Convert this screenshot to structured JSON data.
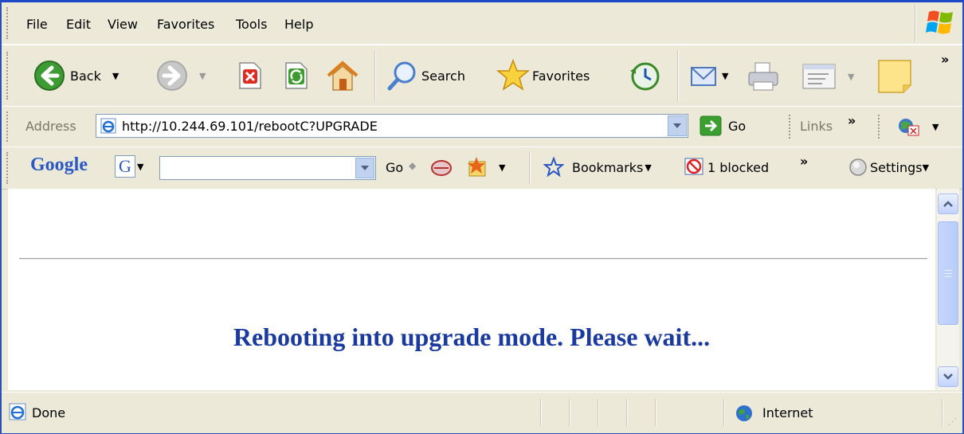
{
  "menu": {
    "items": [
      "File",
      "Edit",
      "View",
      "Favorites",
      "Tools",
      "Help"
    ]
  },
  "toolbar": {
    "back_label": "Back",
    "search_label": "Search",
    "favorites_label": "Favorites"
  },
  "address": {
    "label": "Address",
    "url": "http://10.244.69.101/rebootC?UPGRADE",
    "go_label": "Go",
    "links_label": "Links"
  },
  "google_bar": {
    "logo": "Google",
    "search_value": "",
    "go_label": "Go",
    "bookmarks_label": "Bookmarks",
    "blocked_label": "1 blocked",
    "settings_label": "Settings"
  },
  "page": {
    "message": "Rebooting into upgrade mode. Please wait..."
  },
  "status": {
    "text": "Done",
    "zone": "Internet"
  },
  "colors": {
    "message": "#1a3aa0",
    "chrome": "#ece9d8",
    "border": "#2a4fb5"
  }
}
